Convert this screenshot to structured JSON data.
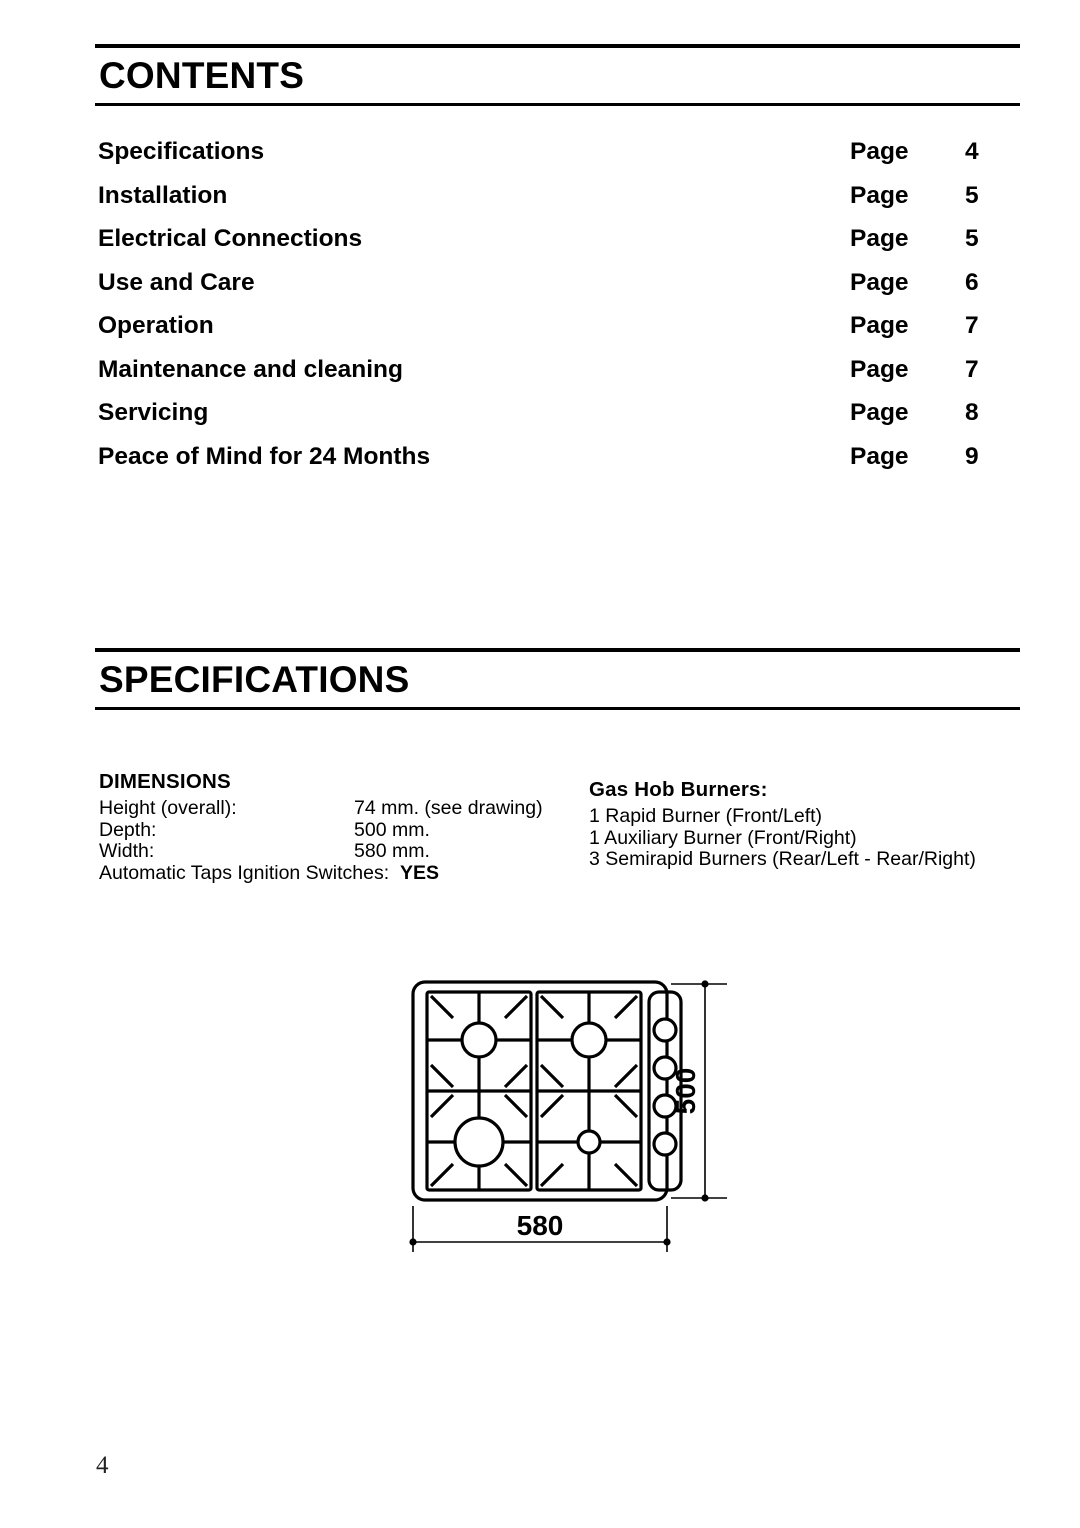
{
  "page": {
    "footer_page_number": "4"
  },
  "contents": {
    "heading": "CONTENTS",
    "rows": [
      {
        "title": "Specifications",
        "page_label": "Page",
        "page_number": "4"
      },
      {
        "title": "Installation",
        "page_label": "Page",
        "page_number": "5"
      },
      {
        "title": "Electrical Connections",
        "page_label": "Page",
        "page_number": "5"
      },
      {
        "title": "Use and Care",
        "page_label": "Page",
        "page_number": "6"
      },
      {
        "title": "Operation",
        "page_label": "Page",
        "page_number": "7"
      },
      {
        "title": "Maintenance and cleaning",
        "page_label": "Page",
        "page_number": "7"
      },
      {
        "title": "Servicing",
        "page_label": "Page",
        "page_number": "8"
      },
      {
        "title": "Peace of Mind for 24 Months",
        "page_label": "Page",
        "page_number": "9"
      }
    ]
  },
  "specifications": {
    "heading": "SPECIFICATIONS",
    "dimensions": {
      "heading": "DIMENSIONS",
      "rows": [
        {
          "label": "Height (overall):",
          "value": "74 mm. (see drawing)"
        },
        {
          "label": "Depth:",
          "value": "500 mm."
        },
        {
          "label": "Width:",
          "value": "580 mm."
        }
      ],
      "ignition_label": "Automatic Taps Ignition Switches:",
      "ignition_value": "YES"
    },
    "burners": {
      "heading": "Gas Hob Burners:",
      "items": [
        "1 Rapid Burner (Front/Left)",
        "1 Auxiliary Burner (Front/Right)",
        "3 Semirapid Burners (Rear/Left - Rear/Right)"
      ]
    },
    "drawing": {
      "width_dimension": "580",
      "depth_dimension": "500"
    }
  }
}
